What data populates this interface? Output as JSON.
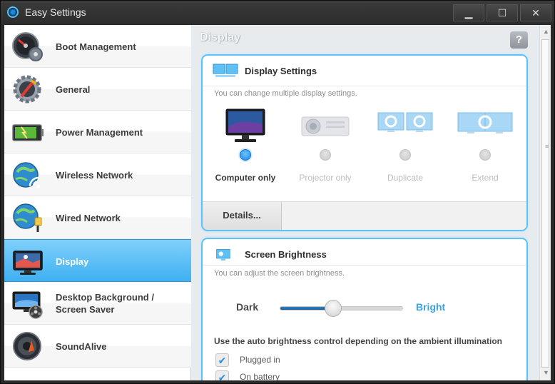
{
  "window": {
    "title": "Easy Settings",
    "minimize_glyph": "▁",
    "maximize_glyph": "☐",
    "close_glyph": "✕"
  },
  "sidebar": {
    "items": [
      {
        "label": "Boot Management",
        "icon": "speedometer-icon",
        "active": false
      },
      {
        "label": "General",
        "icon": "gear-icon",
        "active": false
      },
      {
        "label": "Power Management",
        "icon": "battery-icon",
        "active": false
      },
      {
        "label": "Wireless Network",
        "icon": "wireless-globe-icon",
        "active": false
      },
      {
        "label": "Wired Network",
        "icon": "wired-globe-icon",
        "active": false
      },
      {
        "label": "Display",
        "icon": "display-icon",
        "active": true
      },
      {
        "label": "Desktop Background / Screen Saver",
        "icon": "desktop-background-icon",
        "active": false
      },
      {
        "label": "SoundAlive",
        "icon": "speaker-icon",
        "active": false
      }
    ]
  },
  "content": {
    "title": "Display",
    "help_glyph": "?",
    "display_settings": {
      "title": "Display Settings",
      "description": "You can change multiple display settings.",
      "modes": [
        {
          "label": "Computer only",
          "icon": "monitor-icon",
          "selected": true
        },
        {
          "label": "Projector only",
          "icon": "projector-icon",
          "selected": false
        },
        {
          "label": "Duplicate",
          "icon": "duplicate-displays-icon",
          "selected": false
        },
        {
          "label": "Extend",
          "icon": "extend-displays-icon",
          "selected": false
        }
      ],
      "details_label": "Details..."
    },
    "screen_brightness": {
      "title": "Screen Brightness",
      "description": "You can adjust the screen brightness.",
      "dark_label": "Dark",
      "bright_label": "Bright",
      "level": 0.43,
      "auto_label": "Use the auto brightness control depending on the ambient illumination",
      "options": [
        {
          "label": "Plugged in",
          "checked": true
        },
        {
          "label": "On battery",
          "checked": true
        }
      ]
    }
  },
  "colors": {
    "accent": "#3fb0f1",
    "panel_border": "#5bc3f5",
    "bright_text": "#3aa3e6"
  }
}
